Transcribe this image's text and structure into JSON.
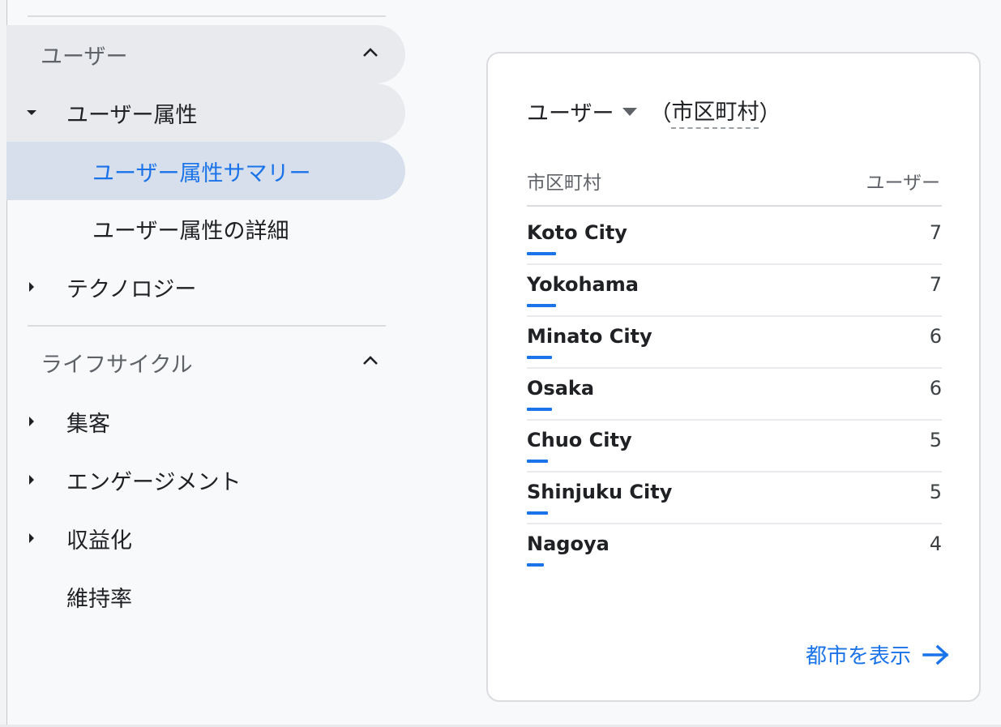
{
  "sidebar": {
    "users_section": {
      "label": "ユーザー"
    },
    "user_attributes": {
      "label": "ユーザー属性"
    },
    "attr_summary": {
      "label": "ユーザー属性サマリー"
    },
    "attr_detail": {
      "label": "ユーザー属性の詳細"
    },
    "technology": {
      "label": "テクノロジー"
    },
    "lifecycle_section": {
      "label": "ライフサイクル"
    },
    "acquisition": {
      "label": "集客"
    },
    "engagement": {
      "label": "エンゲージメント"
    },
    "monetization": {
      "label": "収益化"
    },
    "retention": {
      "label": "維持率"
    }
  },
  "card": {
    "metric_label": "ユーザー",
    "paren_open": "（",
    "dimension_label": "市区町村",
    "paren_close": "）",
    "col_dimension": "市区町村",
    "col_metric": "ユーザー",
    "rows": [
      {
        "city": "Koto City",
        "value": "7",
        "share": 1.0
      },
      {
        "city": "Yokohama",
        "value": "7",
        "share": 1.0
      },
      {
        "city": "Minato City",
        "value": "6",
        "share": 0.857
      },
      {
        "city": "Osaka",
        "value": "6",
        "share": 0.857
      },
      {
        "city": "Chuo City",
        "value": "5",
        "share": 0.714
      },
      {
        "city": "Shinjuku City",
        "value": "5",
        "share": 0.714
      },
      {
        "city": "Nagoya",
        "value": "4",
        "share": 0.571
      }
    ],
    "view_link": "都市を表示"
  },
  "colors": {
    "accent": "#1a73e8",
    "selected_bg": "#d7dfec",
    "section_bg": "#e8eaed"
  },
  "icons": {
    "collapse": "chevron-up-icon",
    "expanded": "caret-down-icon",
    "collapsed": "caret-right-icon",
    "dropdown": "dropdown-arrow-icon",
    "link": "arrow-right-icon"
  }
}
